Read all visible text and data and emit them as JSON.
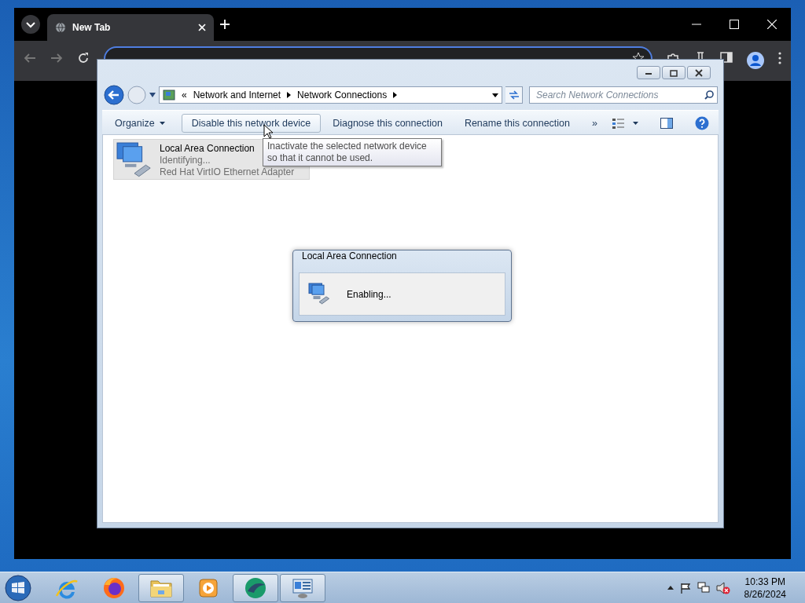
{
  "browser": {
    "tabs": [
      {
        "title": "New Tab",
        "selected": true
      }
    ]
  },
  "explorer": {
    "breadcrumb_overflow": "«",
    "breadcrumb": [
      "Network and Internet",
      "Network Connections"
    ],
    "search": {
      "placeholder": "Search Network Connections"
    },
    "toolbar": [
      {
        "label": "Organize",
        "kind": "menu",
        "selected": false
      },
      {
        "label": "Disable this network device",
        "kind": "command",
        "selected": true
      },
      {
        "label": "Diagnose this connection",
        "kind": "command",
        "selected": false
      },
      {
        "label": "Rename this connection",
        "kind": "command",
        "selected": false
      }
    ],
    "toolbar_overflow": "»",
    "connections": [
      {
        "name": "Local Area Connection",
        "status": "Identifying...",
        "adapter": "Red Hat VirtIO Ethernet Adapter",
        "selected": true
      }
    ],
    "tooltip": "Inactivate the selected network device so that it cannot be used."
  },
  "dialog": {
    "title": "Local Area Connection",
    "message": "Enabling..."
  },
  "taskbar": {
    "apps": [
      {
        "kind": "browser-e",
        "open": false
      },
      {
        "kind": "fox",
        "open": false
      },
      {
        "kind": "folder",
        "open": true
      },
      {
        "kind": "media",
        "open": false
      },
      {
        "kind": "green",
        "open": true
      },
      {
        "kind": "network",
        "open": true
      }
    ],
    "clock": {
      "time": "10:33 PM",
      "date": "8/26/2024"
    }
  }
}
